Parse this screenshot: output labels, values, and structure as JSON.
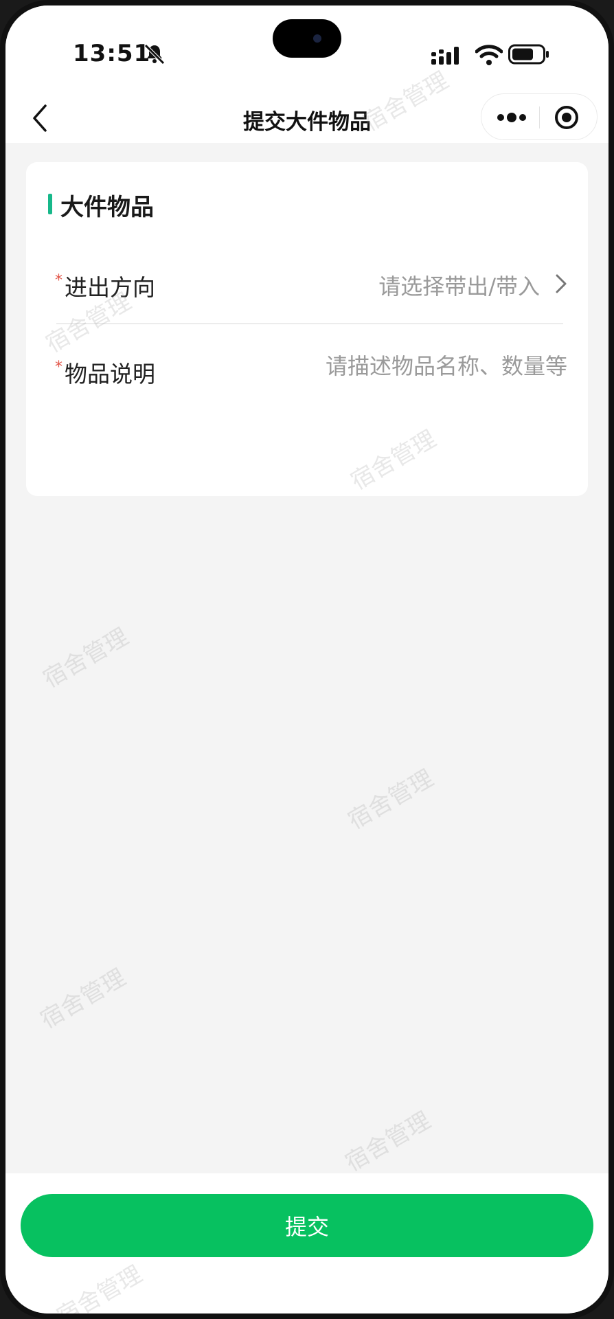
{
  "status_bar": {
    "time": "13:51"
  },
  "nav": {
    "title": "提交大件物品"
  },
  "form": {
    "section_title": "大件物品",
    "required_mark": "*",
    "direction": {
      "label": "进出方向",
      "placeholder": "请选择带出/带入"
    },
    "description": {
      "label": "物品说明",
      "placeholder": "请描述物品名称、数量等"
    }
  },
  "watermark": "宿舍管理",
  "footer": {
    "submit_label": "提交"
  },
  "colors": {
    "accent_bar": "#17b88a",
    "primary_button": "#07c160",
    "required_star": "#e2564a",
    "page_bg": "#f4f4f4"
  },
  "icons": [
    "bell-slash-icon",
    "signal-icon",
    "wifi-icon",
    "battery-icon",
    "back-icon",
    "more-icon",
    "target-icon",
    "chevron-right-icon"
  ]
}
